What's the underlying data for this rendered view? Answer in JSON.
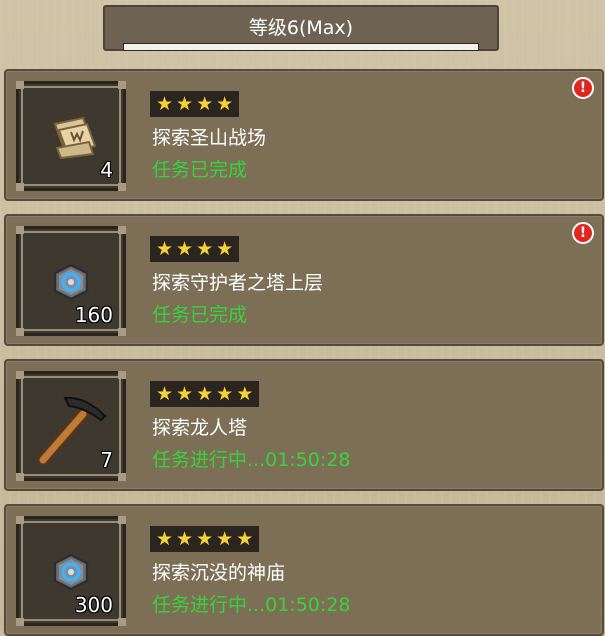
{
  "level": {
    "title": "等级6(Max)",
    "progress": 1.0
  },
  "tasks": [
    {
      "stars": 4,
      "name": "探索圣山战场",
      "status": "任务已完成",
      "count": "4",
      "icon": "scroll-map-icon",
      "alert": "!"
    },
    {
      "stars": 4,
      "name": "探索守护者之塔上层",
      "status": "任务已完成",
      "count": "160",
      "icon": "blue-rune-stone-icon",
      "alert": "!"
    },
    {
      "stars": 5,
      "name": "探索龙人塔",
      "status": "任务进行中...01:50:28",
      "count": "7",
      "icon": "pickaxe-icon"
    },
    {
      "stars": 5,
      "name": "探索沉没的神庙",
      "status": "任务进行中...01:50:28",
      "count": "300",
      "icon": "blue-rune-stone-icon"
    }
  ],
  "colors": {
    "status_green": "#36d43a",
    "star_yellow": "#f7d237",
    "alert_red": "#e0261f"
  }
}
